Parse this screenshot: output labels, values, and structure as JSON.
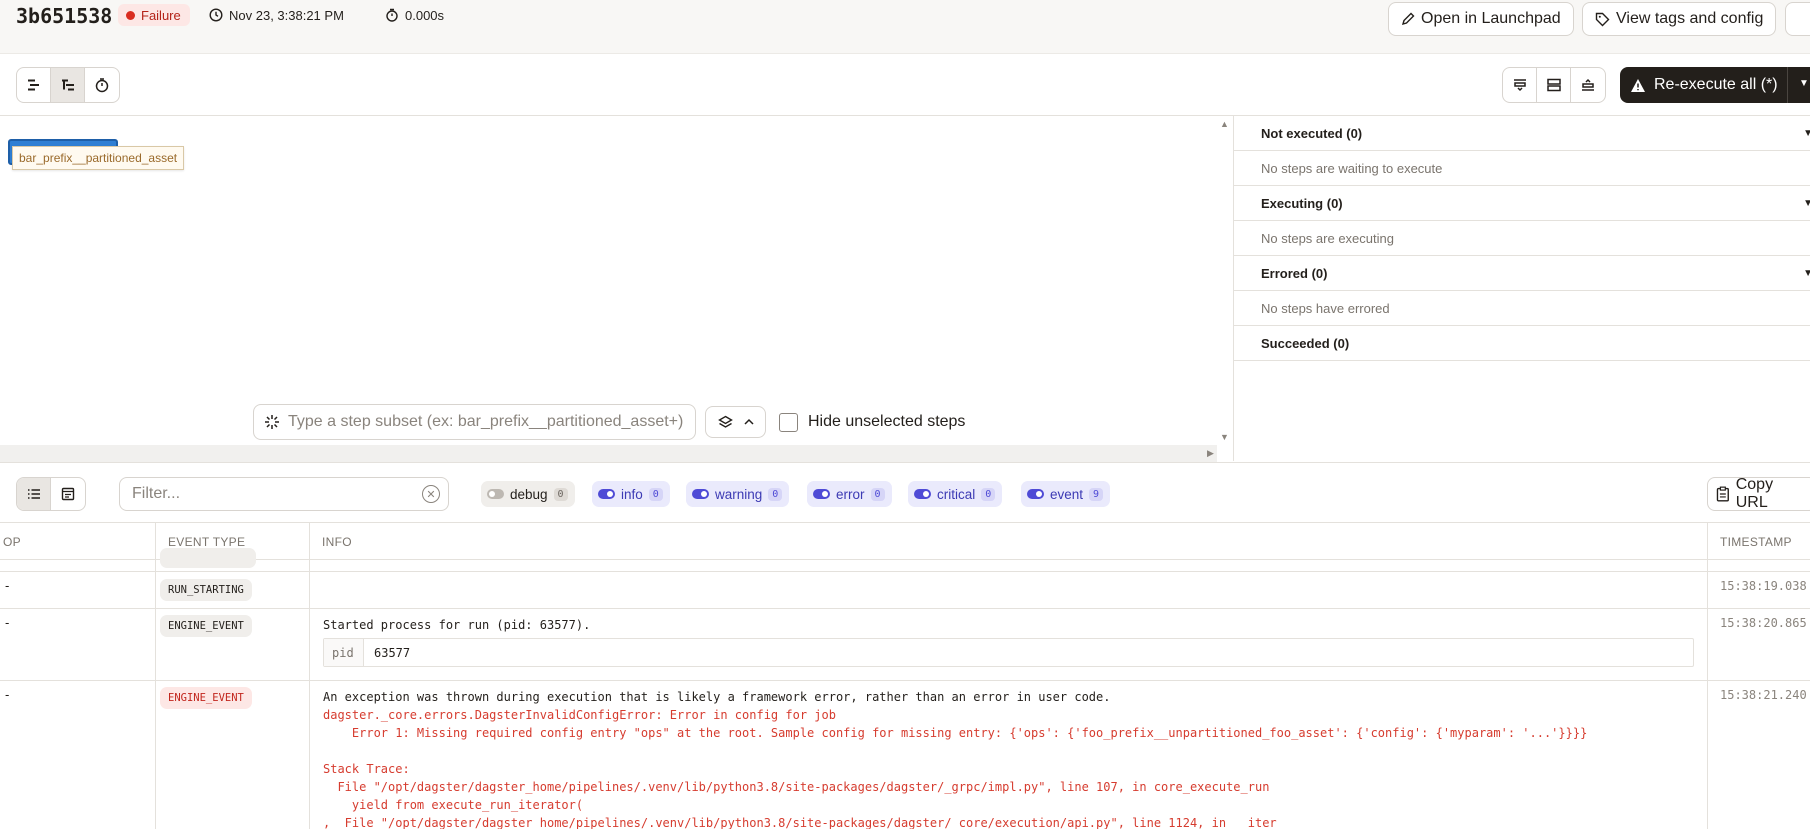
{
  "header": {
    "run_id": "3b651538",
    "status": "Failure",
    "timestamp": "Nov 23, 3:38:21 PM",
    "duration": "0.000s",
    "open_launchpad": "Open in Launchpad",
    "view_tags": "View tags and config"
  },
  "toolbar": {
    "reexecute": "Re-execute all (*)"
  },
  "graph": {
    "node_label": "bar_prefix__partitioned_asset",
    "subset_placeholder": "Type a step subset (ex: bar_prefix__partitioned_asset+)",
    "hide_unselected": "Hide unselected steps"
  },
  "steps_panel": {
    "sections": [
      {
        "title": "Not executed (0)",
        "empty": "No steps are waiting to execute"
      },
      {
        "title": "Executing (0)",
        "empty": "No steps are executing"
      },
      {
        "title": "Errored (0)",
        "empty": "No steps have errored"
      },
      {
        "title": "Succeeded (0)",
        "empty": ""
      }
    ]
  },
  "logs": {
    "filter_placeholder": "Filter...",
    "levels": [
      {
        "name": "debug",
        "count": "0",
        "enabled": false
      },
      {
        "name": "info",
        "count": "0",
        "enabled": true
      },
      {
        "name": "warning",
        "count": "0",
        "enabled": true
      },
      {
        "name": "error",
        "count": "0",
        "enabled": true
      },
      {
        "name": "critical",
        "count": "0",
        "enabled": true
      },
      {
        "name": "event",
        "count": "9",
        "enabled": true
      }
    ],
    "copy_url": "Copy URL",
    "columns": {
      "op": "OP",
      "event_type": "EVENT TYPE",
      "info": "INFO",
      "timestamp": "TIMESTAMP"
    },
    "rows": [
      {
        "op": "-",
        "event_type": "RUN_STARTING",
        "timestamp": "15:38:19.038"
      },
      {
        "op": "-",
        "event_type": "ENGINE_EVENT",
        "timestamp": "15:38:20.865",
        "info": "Started process for run (pid: 63577).",
        "kv_key": "pid",
        "kv_value": "63577"
      },
      {
        "op": "-",
        "event_type": "ENGINE_EVENT",
        "timestamp": "15:38:21.240",
        "info": "An exception was thrown during execution that is likely a framework error, rather than an error in user code.",
        "error_lines": [
          "dagster._core.errors.DagsterInvalidConfigError: Error in config for job",
          "    Error 1: Missing required config entry \"ops\" at the root. Sample config for missing entry: {'ops': {'foo_prefix__unpartitioned_foo_asset': {'config': {'myparam': '...'}}}}",
          "",
          "Stack Trace:",
          "  File \"/opt/dagster/dagster_home/pipelines/.venv/lib/python3.8/site-packages/dagster/_grpc/impl.py\", line 107, in core_execute_run",
          "    yield from execute_run_iterator(",
          ",  File \"/opt/dagster/dagster_home/pipelines/.venv/lib/python3.8/site-packages/dagster/_core/execution/api.py\", line 1124, in __iter__"
        ]
      }
    ]
  },
  "colors": {
    "accent": "#4f4bd6",
    "failure": "#d92d20",
    "primary_button": "#231f1b"
  }
}
